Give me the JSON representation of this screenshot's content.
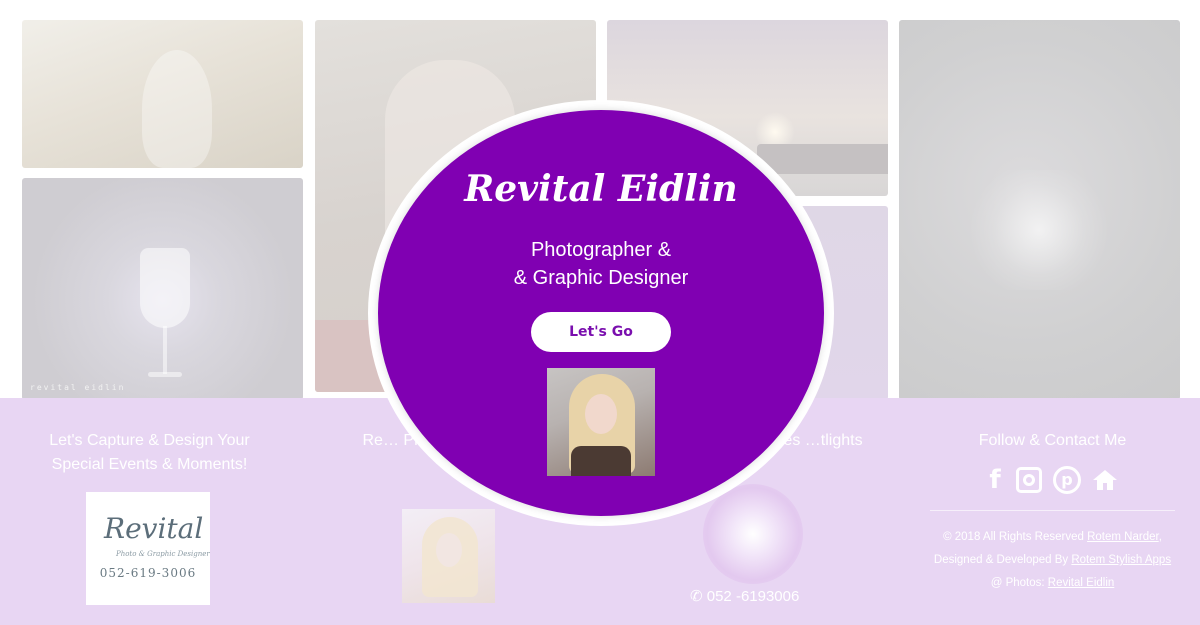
{
  "hero": {
    "name": "Revital Eidlin",
    "role_line1": "Photographer &",
    "role_line2": "& Graphic Designer",
    "cta_label": "Let's Go"
  },
  "gallery": {
    "watermark": "revital eidlin"
  },
  "footer": {
    "col1_heading": "Let's Capture & Design Your Special Events & Moments!",
    "logo_script": "Revital",
    "logo_tagline": "Photo & Graphic Designer",
    "logo_phone": "052-619-3006",
    "col2_heading_partial": "Re… Photograp… Design",
    "col3_heading_partial": "…emories …tlights",
    "phone_icon": "phone-icon",
    "phone": "052 -6193006",
    "col4_heading": "Follow & Contact Me",
    "social_icons": [
      "facebook-icon",
      "instagram-icon",
      "pinterest-icon",
      "home-icon"
    ],
    "credits": {
      "rights_prefix": "© 2018 All Rights Reserved",
      "rights_name": "Rotem Narder",
      "designed_prefix": "Designed & Developed By",
      "designed_name": "Rotem Stylish Apps",
      "photos_prefix": "@ Photos:",
      "photos_name": "Revital Eidlin"
    }
  },
  "colors": {
    "brand_purple": "#8000b2",
    "footer_lavender": "#e8d6f3",
    "button_text": "#7a0fae"
  }
}
